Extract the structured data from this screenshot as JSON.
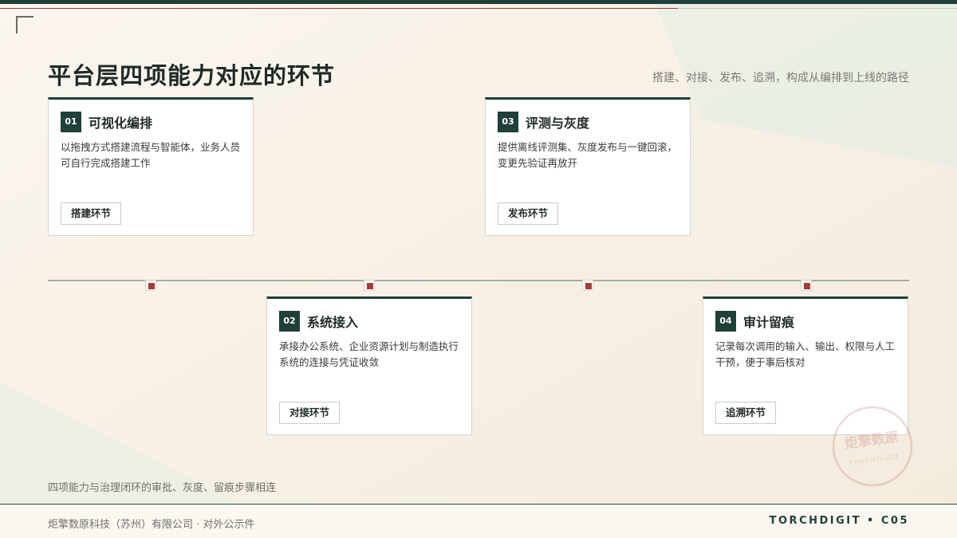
{
  "header": {
    "title": "平台层四项能力对应的环节",
    "subtitle": "搭建、对接、发布、追溯，构成从编排到上线的路径"
  },
  "cards": [
    {
      "number": "01",
      "title": "可视化编排",
      "description": "以拖拽方式搭建流程与智能体，业务人员可自行完成搭建工作",
      "tag": "搭建环节"
    },
    {
      "number": "02",
      "title": "系统接入",
      "description": "承接办公系统、企业资源计划与制造执行系统的连接与凭证收敛",
      "tag": "对接环节"
    },
    {
      "number": "03",
      "title": "评测与灰度",
      "description": "提供离线评测集、灰度发布与一键回滚，变更先验证再放开",
      "tag": "发布环节"
    },
    {
      "number": "04",
      "title": "审计留痕",
      "description": "记录每次调用的输入、输出、权限与人工干预，便于事后核对",
      "tag": "追溯环节"
    }
  ],
  "footnote": "四项能力与治理闭环的审批、灰度、留痕步骤相连",
  "footer": {
    "company": "炬擎数原科技（苏州）有限公司 · 对外公示件",
    "code": "TORCHDIGIT • C05"
  },
  "seal": {
    "text_cn": "炬擎数原",
    "text_en": "TORCHDIGIT"
  },
  "colors": {
    "primary": "#1f3f38",
    "accent": "#a63c35",
    "background": "#f6f0e6"
  }
}
